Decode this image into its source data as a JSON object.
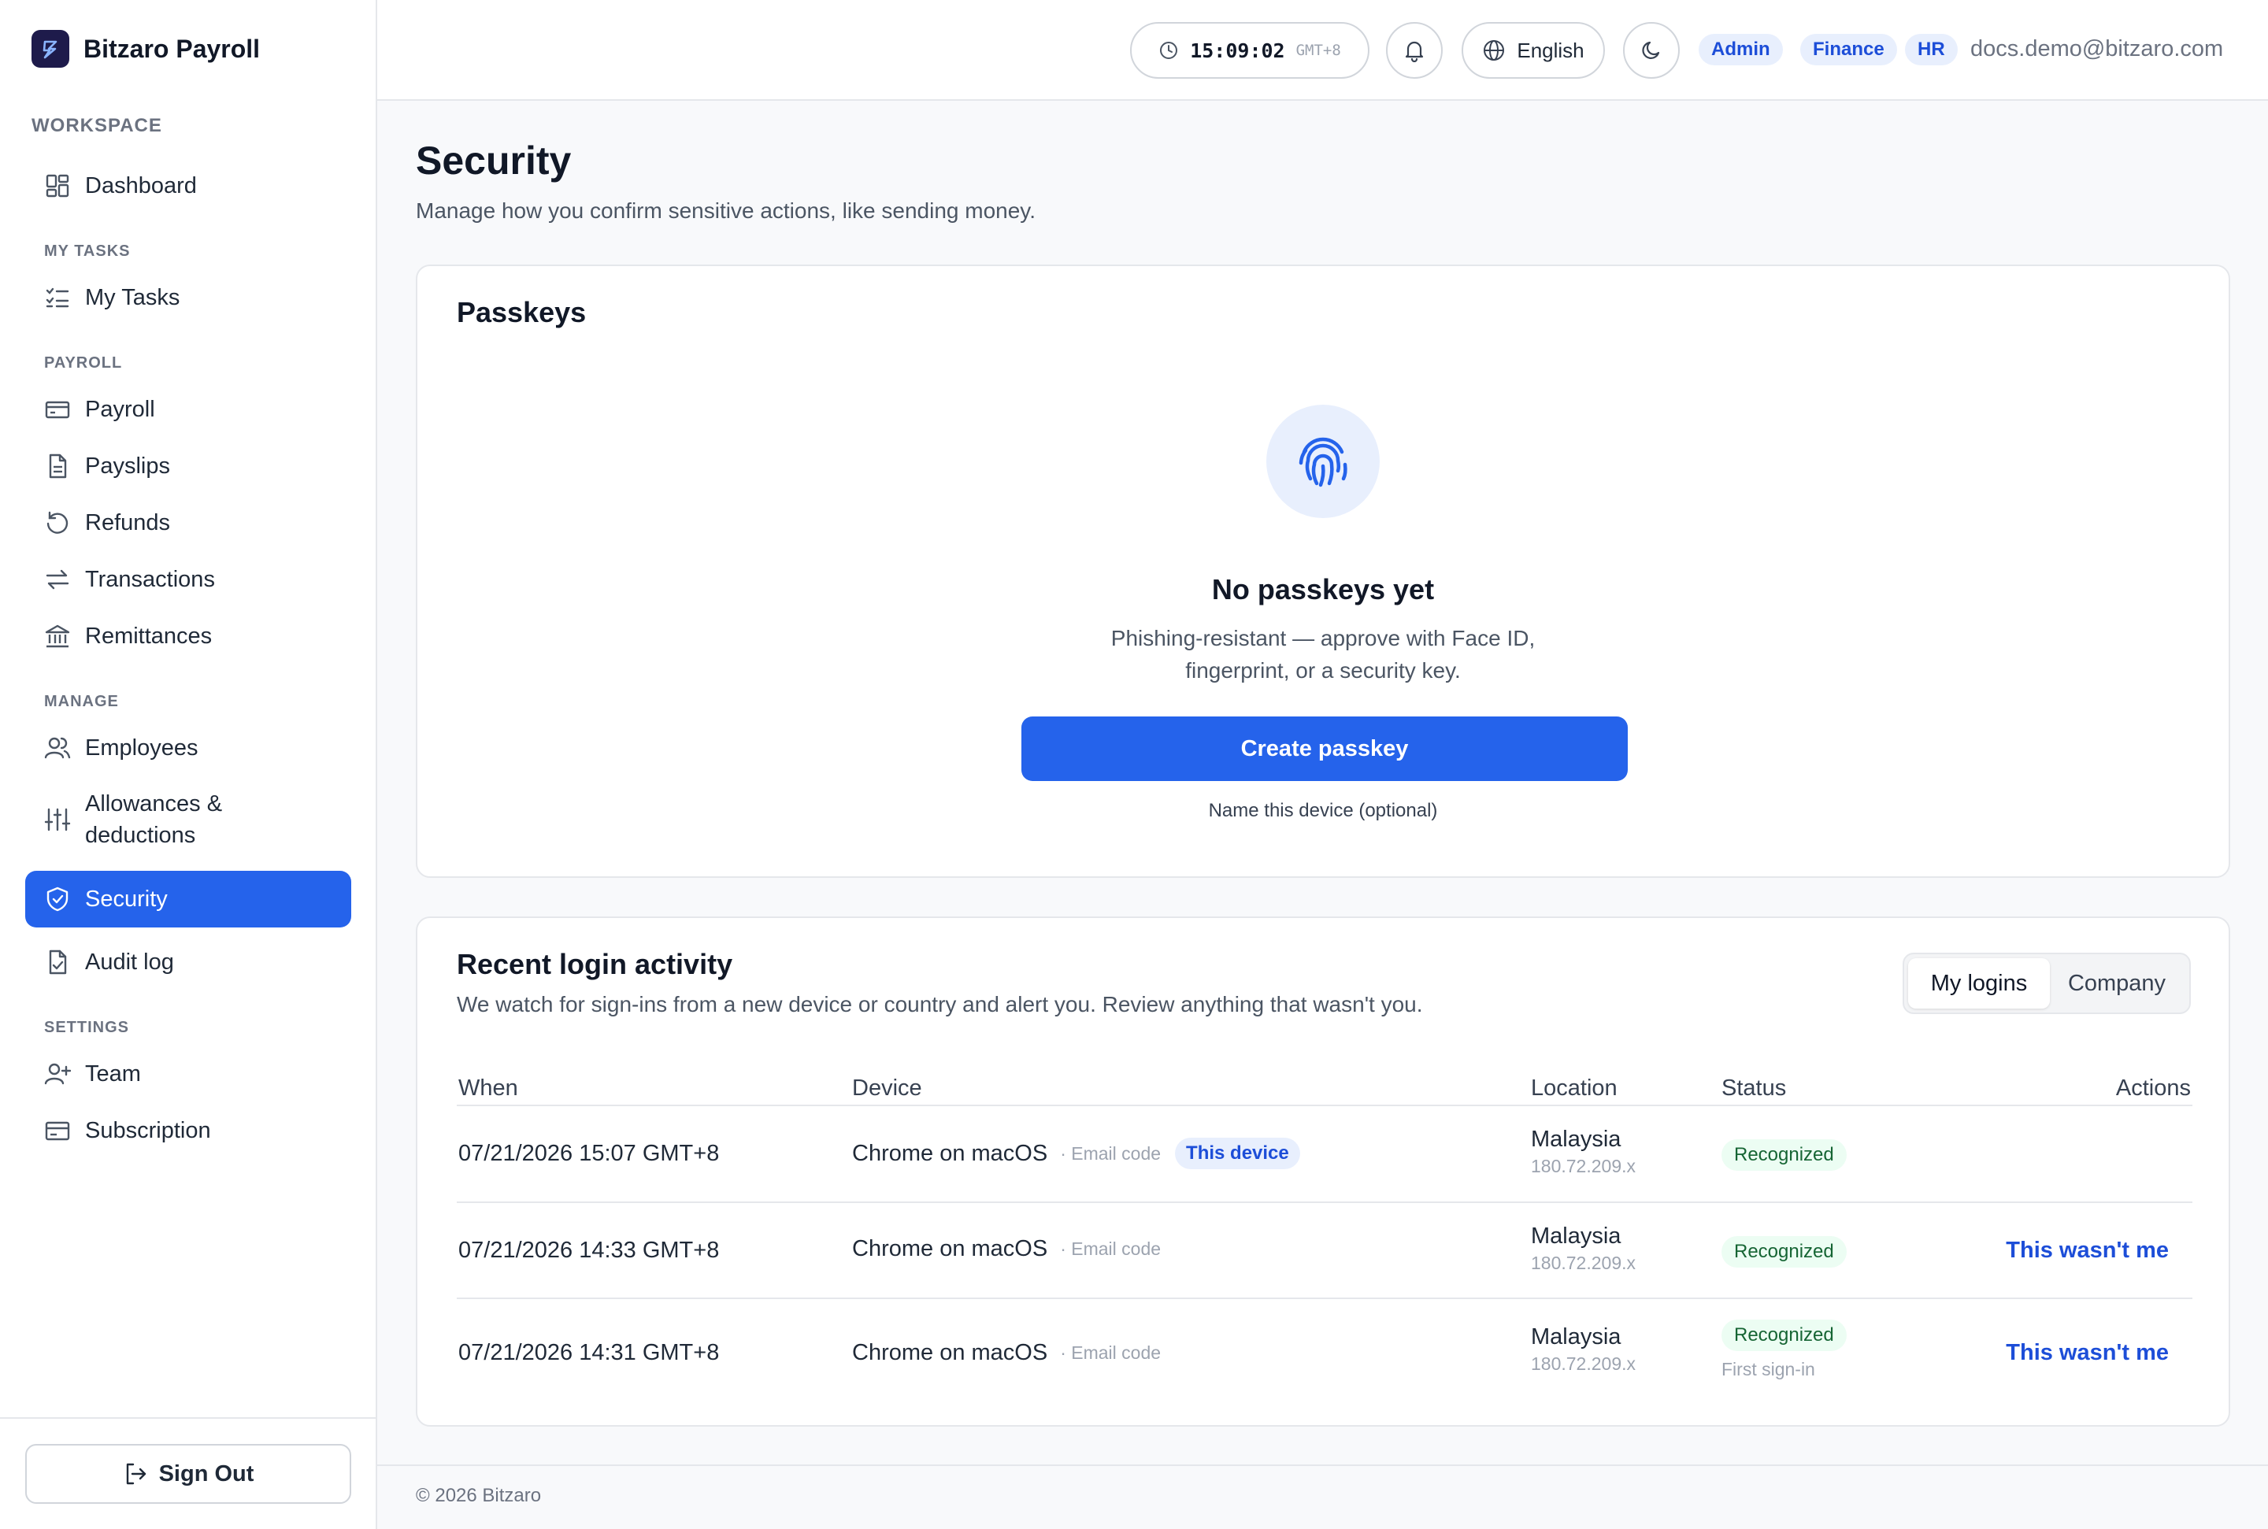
{
  "app": {
    "name": "Bitzaro Payroll"
  },
  "sidebar": {
    "workspace_label": "WORKSPACE",
    "dashboard": "Dashboard",
    "groups": {
      "my_tasks": "MY TASKS",
      "payroll": "PAYROLL",
      "manage": "MANAGE",
      "settings": "SETTINGS"
    },
    "items": {
      "my_tasks": "My Tasks",
      "payroll": "Payroll",
      "payslips": "Payslips",
      "refunds": "Refunds",
      "transactions": "Transactions",
      "remittances": "Remittances",
      "employees": "Employees",
      "allowances_line1": "Allowances &",
      "allowances_line2": "deductions",
      "security": "Security",
      "audit_log": "Audit log",
      "team": "Team",
      "subscription": "Subscription"
    },
    "active_item": "Security",
    "sign_out": "Sign Out"
  },
  "topbar": {
    "time": "15:09:02",
    "timezone": "GMT+8",
    "language": "English",
    "roles": [
      "Admin",
      "Finance",
      "HR"
    ],
    "email": "docs.demo@bitzaro.com"
  },
  "page": {
    "title": "Security",
    "subtitle": "Manage how you confirm sensitive actions, like sending money."
  },
  "passkeys": {
    "title": "Passkeys",
    "empty_title": "No passkeys yet",
    "empty_desc_line1": "Phishing-resistant — approve with Face ID,",
    "empty_desc_line2": "fingerprint, or a security key.",
    "create_button": "Create passkey",
    "name_device": "Name this device (optional)"
  },
  "activity": {
    "title": "Recent login activity",
    "description": "We watch for sign-ins from a new device or country and alert you. Review anything that wasn't you.",
    "tabs": [
      "My logins",
      "Company"
    ],
    "selected_tab": "My logins",
    "columns": [
      "When",
      "Device",
      "Location",
      "Status",
      "Actions"
    ],
    "rows": [
      {
        "when": "07/21/2026 15:07 GMT+8",
        "device": "Chrome on macOS",
        "method": "· Email code",
        "tag": "This device",
        "country": "Malaysia",
        "ip": "180.72.209.x",
        "status": "Recognized",
        "note": "",
        "action": ""
      },
      {
        "when": "07/21/2026 14:33 GMT+8",
        "device": "Chrome on macOS",
        "method": "· Email code",
        "tag": "",
        "country": "Malaysia",
        "ip": "180.72.209.x",
        "status": "Recognized",
        "note": "",
        "action": "This wasn't me"
      },
      {
        "when": "07/21/2026 14:31 GMT+8",
        "device": "Chrome on macOS",
        "method": "· Email code",
        "tag": "",
        "country": "Malaysia",
        "ip": "180.72.209.x",
        "status": "Recognized",
        "note": "First sign-in",
        "action": "This wasn't me"
      }
    ]
  },
  "footer": {
    "copyright": "© 2026 Bitzaro"
  },
  "colors": {
    "accent": "#2563eb",
    "brand_dark": "#1e1b4b",
    "success_bg": "#ecfdf3",
    "success_text": "#166534"
  },
  "icons": {
    "brand": "bitzaro-logo-icon",
    "dashboard": "grid-icon",
    "my_tasks": "checklist-icon",
    "payroll": "credit-card-icon",
    "payslips": "document-icon",
    "refunds": "refund-icon",
    "transactions": "arrows-swap-icon",
    "remittances": "bank-icon",
    "employees": "users-icon",
    "allowances": "sliders-icon",
    "security": "shield-icon",
    "audit_log": "file-check-icon",
    "team": "user-plus-icon",
    "subscription": "card-icon",
    "sign_out": "logout-icon",
    "clock": "clock-icon",
    "bell": "bell-icon",
    "globe": "globe-icon",
    "theme": "moon-icon",
    "passkey": "fingerprint-icon"
  }
}
